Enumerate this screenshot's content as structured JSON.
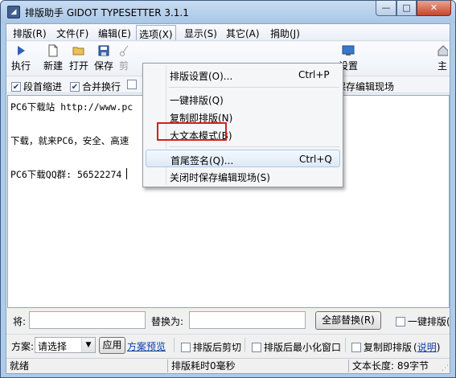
{
  "window": {
    "title": "排版助手 GIDOT TYPESETTER 3.1.1",
    "caption_minimize": "—",
    "caption_maximize": "□",
    "caption_close": "✕"
  },
  "menubar": {
    "items": [
      "排版(R)",
      "文件(F)",
      "编辑(E)",
      "选项(X)",
      "显示(S)",
      "其它(A)",
      "捐助(J)"
    ],
    "active_index": 3
  },
  "toolbar": {
    "buttons": [
      {
        "label": "执行",
        "icon": "play-icon"
      },
      {
        "label": "新建",
        "icon": "new-file-icon"
      },
      {
        "label": "打开",
        "icon": "open-folder-icon"
      },
      {
        "label": "保存",
        "icon": "save-icon"
      },
      {
        "label": "剪",
        "icon": "cut-icon"
      },
      {
        "label": "设置",
        "icon": "settings-monitor-icon"
      },
      {
        "label": "主",
        "icon": "home-icon"
      }
    ]
  },
  "options_bar": {
    "indent_first": {
      "label": "段首缩进",
      "checked": true
    },
    "merge_lines": {
      "label": "合并换行",
      "checked": true
    },
    "save_on_close": {
      "label": "保存编辑现场"
    }
  },
  "editor": {
    "lines": [
      "PC6下载站 http://www.pc",
      "下载，就来PC6，安全、高速",
      "PC6下载QQ群: 56522274"
    ]
  },
  "find_replace": {
    "find_label": "将:",
    "replace_label": "替换为:",
    "replace_all_button": "全部替换(R)",
    "one_key_label": "一键排版("
  },
  "scheme": {
    "label": "方案:",
    "select_value": "请选择",
    "apply_button": "应用",
    "preview_link": "方案预览",
    "cut_after": "排版后剪切",
    "minimize_after": "排版后最小化窗口",
    "copy_and_format": "复制即排版",
    "help_link": "说明",
    "paren_open": "(",
    "paren_close": ")"
  },
  "status": {
    "ready": "就绪",
    "time": "排版耗时0毫秒",
    "length": "文本长度: 89字节"
  },
  "dropdown": {
    "items": [
      {
        "label": "排版设置(O)...",
        "shortcut": "Ctrl+P"
      },
      {
        "label": "一键排版(Q)",
        "shortcut": ""
      },
      {
        "label": "复制即排版(N)",
        "shortcut": ""
      },
      {
        "label": "大文本模式(B)",
        "shortcut": ""
      },
      {
        "label": "首尾签名(Q)...",
        "shortcut": "Ctrl+Q"
      },
      {
        "label": "关闭时保存编辑现场(S)",
        "shortcut": ""
      }
    ],
    "highlighted_index": 4
  },
  "colors": {
    "title_bar": "#aecbe8",
    "highlight_border": "#d22020",
    "link": "#0b3fa8"
  }
}
